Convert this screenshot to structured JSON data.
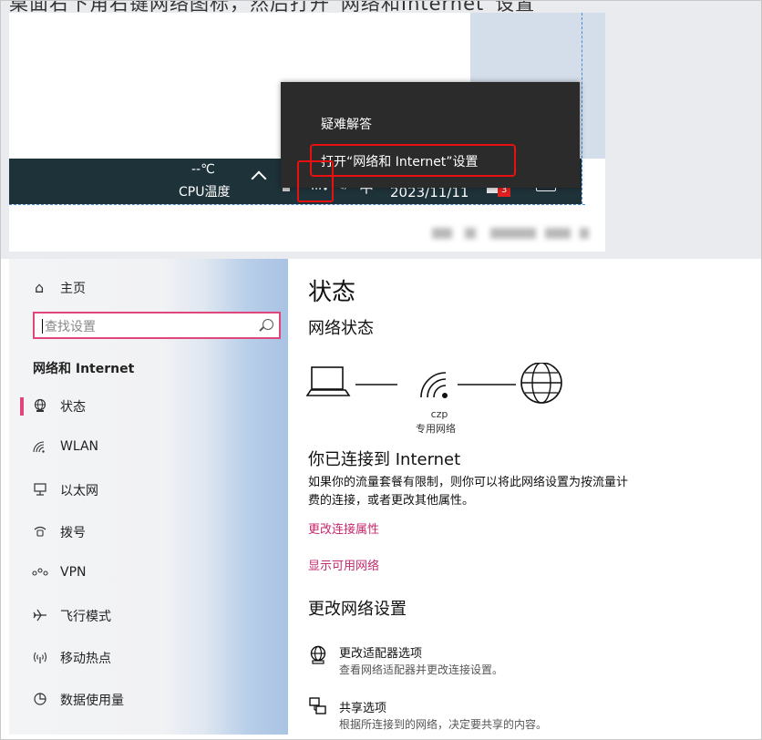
{
  "top": {
    "caption": "桌面右下角右键网络图标，然后打开“网络和Internet”设置",
    "taskbar": {
      "temp_value": "--℃",
      "temp_label": "CPU温度",
      "ime": "中",
      "date": "2023/11/11",
      "notification_count": "3"
    },
    "context_menu": {
      "troubleshoot": "疑难解答",
      "open_settings": "打开“网络和 Internet”设置"
    }
  },
  "sidebar": {
    "home": "主页",
    "search_placeholder": "查找设置",
    "section_title": "网络和 Internet",
    "items": [
      {
        "label": "状态",
        "icon": "globe-icon"
      },
      {
        "label": "WLAN",
        "icon": "wifi-icon"
      },
      {
        "label": "以太网",
        "icon": "ethernet-icon"
      },
      {
        "label": "拨号",
        "icon": "dialup-icon"
      },
      {
        "label": "VPN",
        "icon": "vpn-icon"
      },
      {
        "label": "飞行模式",
        "icon": "airplane-icon"
      },
      {
        "label": "移动热点",
        "icon": "hotspot-icon"
      },
      {
        "label": "数据使用量",
        "icon": "data-usage-icon"
      }
    ]
  },
  "main": {
    "title": "状态",
    "network_status_heading": "网络状态",
    "network_name": "czp",
    "network_type": "专用网络",
    "connected_heading": "你已连接到 Internet",
    "description_line1": "如果你的流量套餐有限制，则你可以将此网络设置为按流量计",
    "description_line2": "费的连接，或者更改其他属性。",
    "link_change_properties": "更改连接属性",
    "link_show_networks": "显示可用网络",
    "change_settings_heading": "更改网络设置",
    "adapter_title": "更改适配器选项",
    "adapter_desc": "查看网络适配器并更改连接设置。",
    "sharing_title": "共享选项",
    "sharing_desc": "根据所连接到的网络，决定要共享的内容。"
  },
  "colors": {
    "accent": "#c5286c",
    "highlight_red": "#e81010",
    "taskbar_bg": "#1e3239",
    "menu_bg": "#2b2b2b"
  }
}
